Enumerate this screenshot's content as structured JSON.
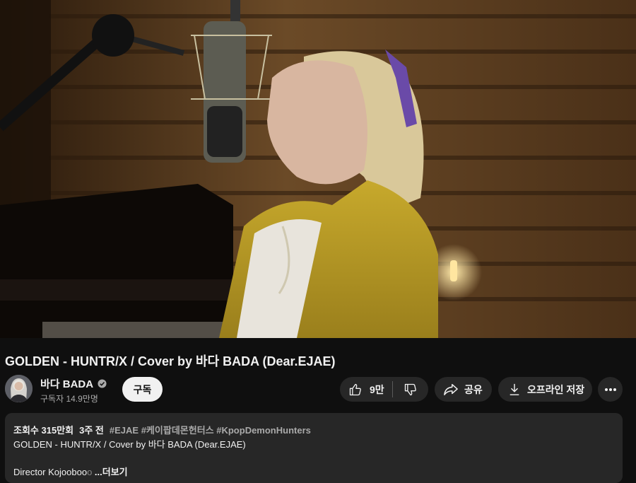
{
  "video": {
    "title": "GOLDEN - HUNTR/X / Cover by 바다 BADA (Dear.EJAE)"
  },
  "channel": {
    "name": "바다 BADA",
    "subscribers": "구독자 14.9만명",
    "subscribe_label": "구독"
  },
  "actions": {
    "likes": "9만",
    "share_label": "공유",
    "offline_label": "오프라인 저장"
  },
  "description": {
    "views": "조회수 315만회",
    "age": "3주 전",
    "hashtags": [
      "#EJAE",
      "#케이팝데몬헌터스",
      "#KpopDemonHunters"
    ],
    "line1": "GOLDEN - HUNTR/X / Cover by 바다 BADA (Dear.EJAE)",
    "line2_visible": "Director Kojooboo",
    "more_label": "...더보기"
  },
  "icons": {
    "verified": "verified-check-icon",
    "like": "thumbs-up-icon",
    "dislike": "thumbs-down-icon",
    "share": "share-arrow-icon",
    "download": "download-icon",
    "more": "more-horizontal-icon"
  },
  "colors": {
    "background": "#0f0f0f",
    "pill": "#272727",
    "subscribe_bg": "#f1f1f1",
    "secondary_text": "#aaaaaa"
  }
}
